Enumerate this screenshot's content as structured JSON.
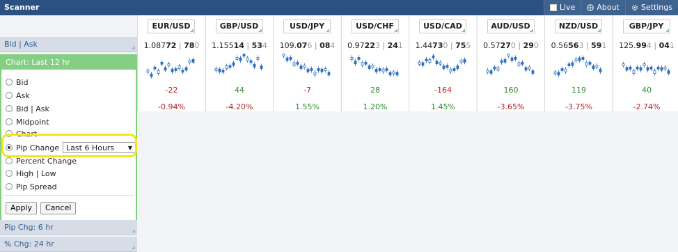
{
  "app": {
    "title": "Scanner"
  },
  "nav": [
    {
      "label": "Live",
      "icon": "checkbox-icon"
    },
    {
      "label": "About",
      "icon": "globe-icon"
    },
    {
      "label": "Settings",
      "icon": "gear-icon"
    }
  ],
  "sidebar": {
    "bid_ask_label": "Bid | Ask",
    "chart_header": "Chart: Last 12 hr",
    "options": [
      "Bid",
      "Ask",
      "Bid | Ask",
      "Midpoint",
      "Chart",
      "Pip Change",
      "Percent Change",
      "High | Low",
      "Pip Spread"
    ],
    "selected_option": "Pip Change",
    "pip_change_select": "Last 6 Hours",
    "apply_label": "Apply",
    "cancel_label": "Cancel",
    "pip_chg_label": "Pip Chg: 6 hr",
    "pct_chg_label": "% Chg: 24 hr"
  },
  "pairs": [
    {
      "pair": "EUR/USD",
      "p1": "1.087",
      "p2": "72",
      "sep": "|",
      "p3": "78",
      "p4": "0",
      "pips": "-22",
      "pct": "-0.94%",
      "pip_dir": "neg",
      "pct_dir": "neg"
    },
    {
      "pair": "GBP/USD",
      "p1": "1.155",
      "p2": "14",
      "sep": "|",
      "p3": "53",
      "p4": "4",
      "pips": "44",
      "pct": "-4.20%",
      "pip_dir": "pos",
      "pct_dir": "neg"
    },
    {
      "pair": "USD/JPY",
      "p1": "109.",
      "p2": "07",
      "p2b": "6",
      "sep": "|",
      "p3": "08",
      "p4": "4",
      "pips": "-7",
      "pct": "1.55%",
      "pip_dir": "neg",
      "pct_dir": "pos"
    },
    {
      "pair": "USD/CHF",
      "p1": "0.97",
      "p2": "22",
      "p2b": "3",
      "sep": "|",
      "p3": "24",
      "p4": "1",
      "pips": "28",
      "pct": "1.20%",
      "pip_dir": "pos",
      "pct_dir": "pos"
    },
    {
      "pair": "USD/CAD",
      "p1": "1.44",
      "p2": "73",
      "p2b": "0",
      "sep": "|",
      "p3": "75",
      "p4": "5",
      "pips": "-164",
      "pct": "1.45%",
      "pip_dir": "neg",
      "pct_dir": "pos"
    },
    {
      "pair": "AUD/USD",
      "p1": "0.57",
      "p2": "27",
      "p2b": "0",
      "sep": "|",
      "p3": "29",
      "p4": "0",
      "pips": "160",
      "pct": "-3.65%",
      "pip_dir": "pos",
      "pct_dir": "neg"
    },
    {
      "pair": "NZD/USD",
      "p1": "0.56",
      "p2": "56",
      "p2b": "3",
      "sep": "|",
      "p3": "59",
      "p4": "1",
      "pips": "119",
      "pct": "-3.75%",
      "pip_dir": "pos",
      "pct_dir": "neg"
    },
    {
      "pair": "GBP/JPY",
      "p1": "125.",
      "p2": "99",
      "p2b": "4",
      "sep": "|",
      "p3": "04",
      "p4": "1",
      "pips": "40",
      "pct": "-2.74%",
      "pip_dir": "pos",
      "pct_dir": "neg"
    }
  ],
  "colors": {
    "topbar": "#2b5082",
    "accent_green": "#85cf85",
    "candle_blue": "#2f6fbf",
    "negative": "#b22222",
    "positive": "#2e8b2e",
    "highlight": "#f5e614"
  }
}
